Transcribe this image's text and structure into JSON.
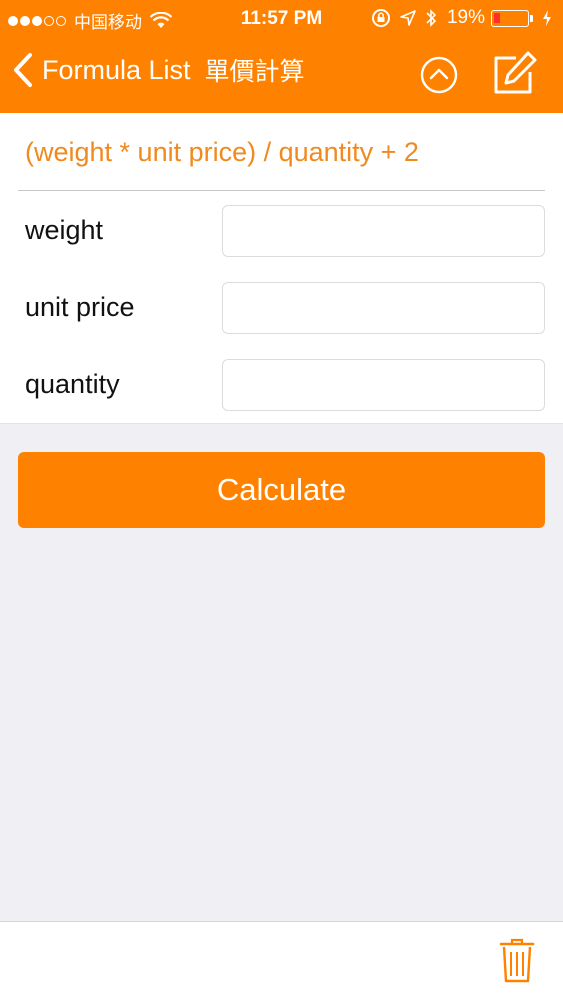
{
  "status_bar": {
    "carrier": "中国移动",
    "time": "11:57 PM",
    "battery_percent": "19%",
    "battery_level": 0.19,
    "signal_bars_filled": 3,
    "signal_bars_total": 5
  },
  "navbar": {
    "back_label": "Formula List",
    "title": "單價計算"
  },
  "form": {
    "formula": "(weight * unit price) / quantity + 2",
    "fields": [
      {
        "label": "weight",
        "value": ""
      },
      {
        "label": "unit price",
        "value": ""
      },
      {
        "label": "quantity",
        "value": ""
      }
    ]
  },
  "actions": {
    "calculate_label": "Calculate"
  },
  "colors": {
    "accent": "#ff8100",
    "formula_text": "#f08a1e",
    "background": "#efeff4"
  }
}
